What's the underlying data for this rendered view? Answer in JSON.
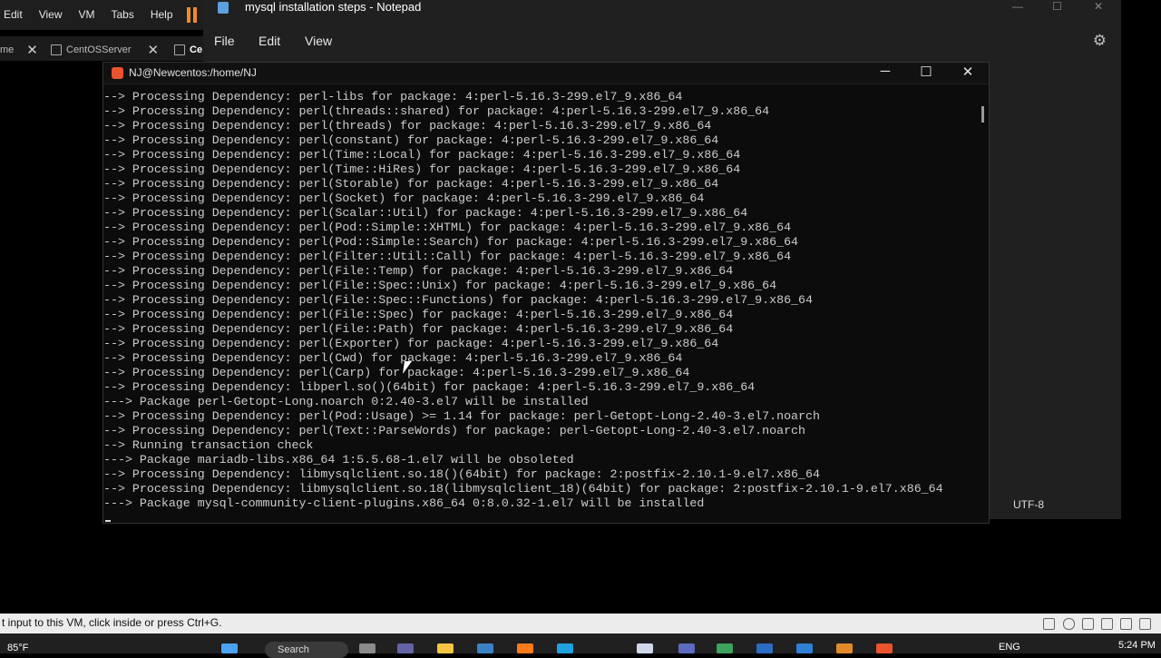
{
  "vmware": {
    "menu": [
      "Edit",
      "View",
      "VM",
      "Tabs",
      "Help"
    ],
    "tabs": [
      {
        "label": "me",
        "close": "✕"
      },
      {
        "label": "CentOSServer",
        "close": "✕"
      },
      {
        "label": "Ce"
      }
    ],
    "status_text": "t input to this VM, click inside or press Ctrl+G."
  },
  "notepad": {
    "title": "mysql installation steps - Notepad",
    "menu": [
      "File",
      "Edit",
      "View"
    ],
    "encoding": "UTF-8",
    "controls": [
      "—",
      "☐",
      "✕"
    ]
  },
  "terminal": {
    "title": "NJ@Newcentos:/home/NJ",
    "controls": [
      "─",
      "☐",
      "✕"
    ],
    "lines": [
      "--> Processing Dependency: perl-libs for package: 4:perl-5.16.3-299.el7_9.x86_64",
      "--> Processing Dependency: perl(threads::shared) for package: 4:perl-5.16.3-299.el7_9.x86_64",
      "--> Processing Dependency: perl(threads) for package: 4:perl-5.16.3-299.el7_9.x86_64",
      "--> Processing Dependency: perl(constant) for package: 4:perl-5.16.3-299.el7_9.x86_64",
      "--> Processing Dependency: perl(Time::Local) for package: 4:perl-5.16.3-299.el7_9.x86_64",
      "--> Processing Dependency: perl(Time::HiRes) for package: 4:perl-5.16.3-299.el7_9.x86_64",
      "--> Processing Dependency: perl(Storable) for package: 4:perl-5.16.3-299.el7_9.x86_64",
      "--> Processing Dependency: perl(Socket) for package: 4:perl-5.16.3-299.el7_9.x86_64",
      "--> Processing Dependency: perl(Scalar::Util) for package: 4:perl-5.16.3-299.el7_9.x86_64",
      "--> Processing Dependency: perl(Pod::Simple::XHTML) for package: 4:perl-5.16.3-299.el7_9.x86_64",
      "--> Processing Dependency: perl(Pod::Simple::Search) for package: 4:perl-5.16.3-299.el7_9.x86_64",
      "--> Processing Dependency: perl(Filter::Util::Call) for package: 4:perl-5.16.3-299.el7_9.x86_64",
      "--> Processing Dependency: perl(File::Temp) for package: 4:perl-5.16.3-299.el7_9.x86_64",
      "--> Processing Dependency: perl(File::Spec::Unix) for package: 4:perl-5.16.3-299.el7_9.x86_64",
      "--> Processing Dependency: perl(File::Spec::Functions) for package: 4:perl-5.16.3-299.el7_9.x86_64",
      "--> Processing Dependency: perl(File::Spec) for package: 4:perl-5.16.3-299.el7_9.x86_64",
      "--> Processing Dependency: perl(File::Path) for package: 4:perl-5.16.3-299.el7_9.x86_64",
      "--> Processing Dependency: perl(Exporter) for package: 4:perl-5.16.3-299.el7_9.x86_64",
      "--> Processing Dependency: perl(Cwd) for package: 4:perl-5.16.3-299.el7_9.x86_64",
      "--> Processing Dependency: perl(Carp) for package: 4:perl-5.16.3-299.el7_9.x86_64",
      "--> Processing Dependency: libperl.so()(64bit) for package: 4:perl-5.16.3-299.el7_9.x86_64",
      "---> Package perl-Getopt-Long.noarch 0:2.40-3.el7 will be installed",
      "--> Processing Dependency: perl(Pod::Usage) >= 1.14 for package: perl-Getopt-Long-2.40-3.el7.noarch",
      "--> Processing Dependency: perl(Text::ParseWords) for package: perl-Getopt-Long-2.40-3.el7.noarch",
      "--> Running transaction check",
      "---> Package mariadb-libs.x86_64 1:5.5.68-1.el7 will be obsoleted",
      "--> Processing Dependency: libmysqlclient.so.18()(64bit) for package: 2:postfix-2.10.1-9.el7.x86_64",
      "--> Processing Dependency: libmysqlclient.so.18(libmysqlclient_18)(64bit) for package: 2:postfix-2.10.1-9.el7.x86_64",
      "---> Package mysql-community-client-plugins.x86_64 0:8.0.32-1.el7 will be installed"
    ]
  },
  "taskbar": {
    "weather": "85°F",
    "search": "Search",
    "language": "ENG",
    "time": "5:24 PM"
  },
  "colors": {
    "accent_orange": "#f08a24",
    "terminal_bg": "#0c0c0c",
    "terminal_text": "#cccccc"
  }
}
